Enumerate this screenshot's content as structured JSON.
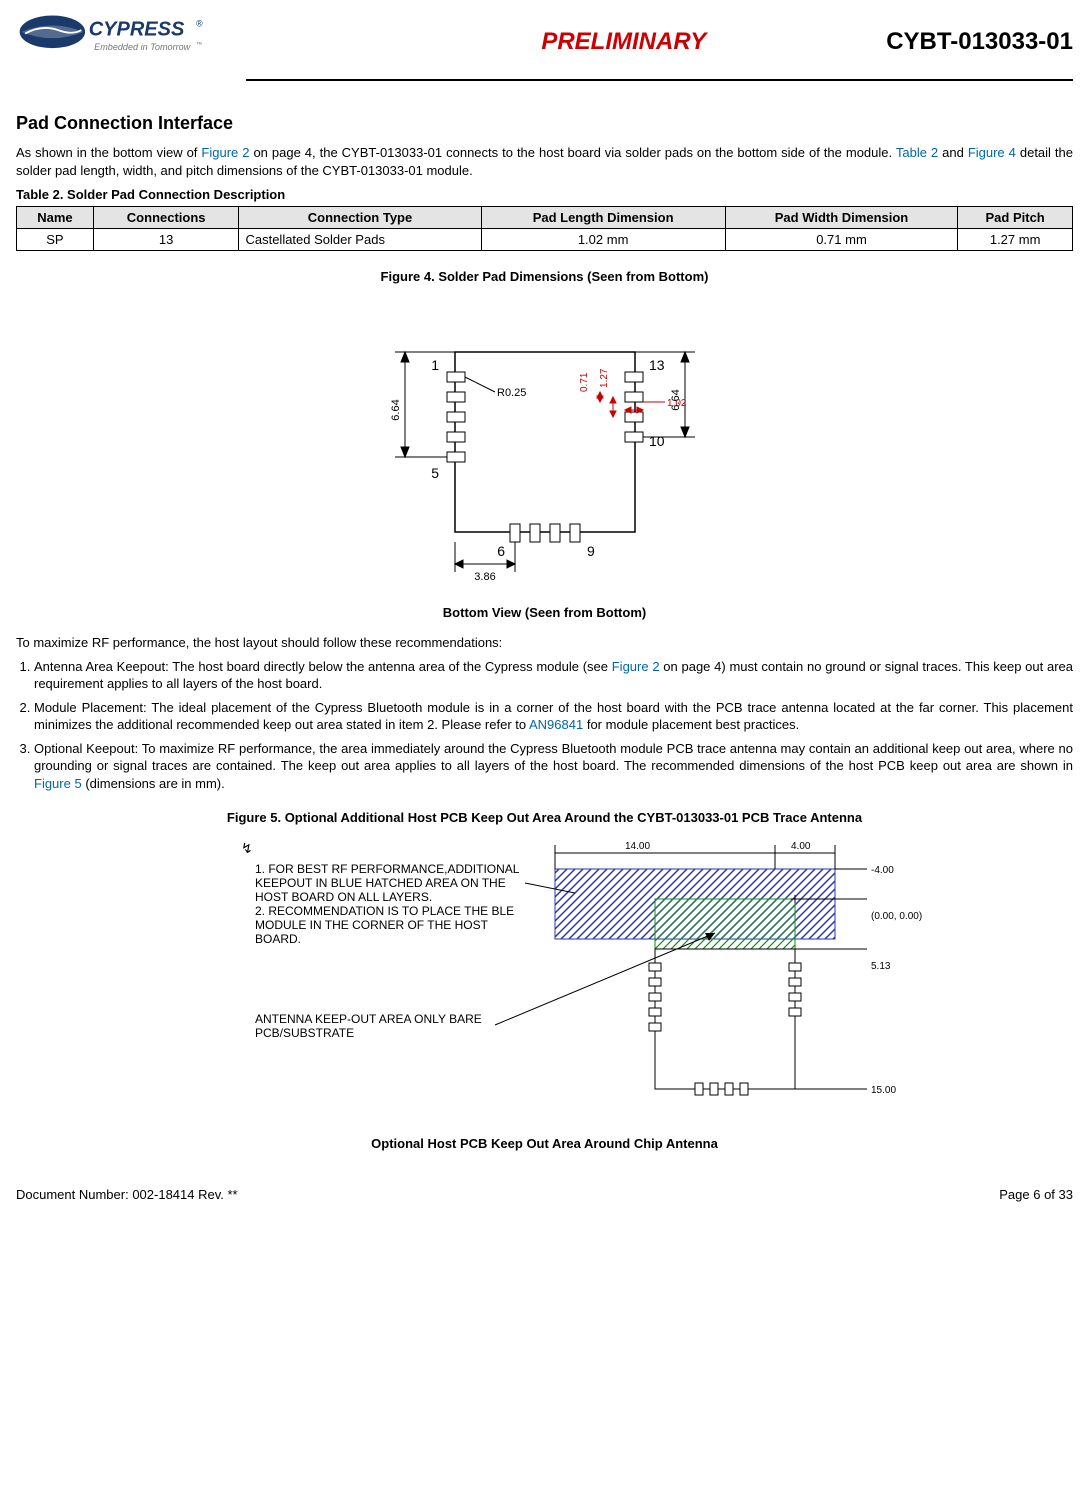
{
  "header": {
    "logo_main": "CYPRESS",
    "logo_tag": "Embedded in Tomorrow",
    "preliminary": "PRELIMINARY",
    "partnum": "CYBT-013033-01"
  },
  "section_title": "Pad Connection Interface",
  "intro_before_fig2": "As shown in the bottom view of ",
  "intro_fig2": "Figure 2",
  "intro_mid1": " on page 4, the CYBT-013033-01 connects to the host board via solder pads on the bottom side of the module. ",
  "intro_tbl2": "Table 2",
  "intro_and": " and ",
  "intro_fig4": "Figure 4",
  "intro_after": " detail the solder pad length, width, and pitch dimensions of the CYBT-013033-01 module.",
  "table2_caption": "Table 2.  Solder Pad Connection Description",
  "table2_headers": [
    "Name",
    "Connections",
    "Connection Type",
    "Pad Length Dimension",
    "Pad Width Dimension",
    "Pad Pitch"
  ],
  "table2_row": [
    "SP",
    "13",
    "Castellated Solder Pads",
    "1.02 mm",
    "0.71 mm",
    "1.27 mm"
  ],
  "fig4_caption": "Figure 4.  Solder Pad Dimensions (Seen from Bottom)",
  "fig4_sub": "Bottom View (Seen from Bottom)",
  "fig4_dims": {
    "left_h": "6.64",
    "right_h": "6.64",
    "pad1": "1",
    "pad5": "5",
    "pad6": "6",
    "pad9": "9",
    "pad10": "10",
    "pad13": "13",
    "r": "R0.25",
    "w": "0.71",
    "p": "1.27",
    "l": "1.02",
    "bottom_in": "3.86"
  },
  "rec_intro": "To maximize RF performance, the host layout should follow these recommendations:",
  "rec1_a": "Antenna Area Keepout: The host board directly below the antenna area of the Cypress module (see ",
  "rec1_link": "Figure 2",
  "rec1_b": " on page 4) must contain no ground or signal traces. This keep out area requirement applies to all layers of the host board.",
  "rec2_a": "Module Placement: The ideal placement of the Cypress Bluetooth module is in a corner of the host board with the PCB trace antenna located at the far corner. This placement minimizes the additional recommended keep out area stated in item 2. Please refer to ",
  "rec2_link": "AN96841",
  "rec2_b": " for module placement best practices.",
  "rec3_a": "Optional Keepout: To maximize RF performance, the area immediately around the Cypress Bluetooth module PCB trace antenna may contain an additional keep out area, where no grounding or signal traces are contained. The keep out area applies to all layers of the host board. The recommended dimensions of the host PCB keep out area are shown in ",
  "rec3_link": "Figure 5",
  "rec3_b": " (dimensions are in mm).",
  "fig5_caption": "Figure 5.  Optional Additional Host PCB Keep Out Area Around the CYBT-013033-01 PCB Trace Antenna",
  "fig5_sub": "Optional Host PCB Keep Out Area Around Chip Antenna",
  "fig5_note1": "1. FOR BEST RF PERFORMANCE,ADDITIONAL KEEPOUT IN BLUE HATCHED AREA ON THE HOST BOARD ON ALL LAYERS.",
  "fig5_note2": "2. RECOMMENDATION IS TO PLACE THE BLE MODULE IN THE CORNER OF THE HOST BOARD.",
  "fig5_note3": "ANTENNA KEEP-OUT AREA ONLY BARE PCB/SUBSTRATE",
  "fig5_dims": {
    "top_w": "14.00",
    "right_w": "4.00",
    "top_y": "-4.00",
    "origin": "(0.00, 0.00)",
    "mid_y": "5.13",
    "bot_y": "15.00"
  },
  "footer": {
    "docnum": "Document Number: 002-18414 Rev. **",
    "page": "Page 6 of 33"
  }
}
